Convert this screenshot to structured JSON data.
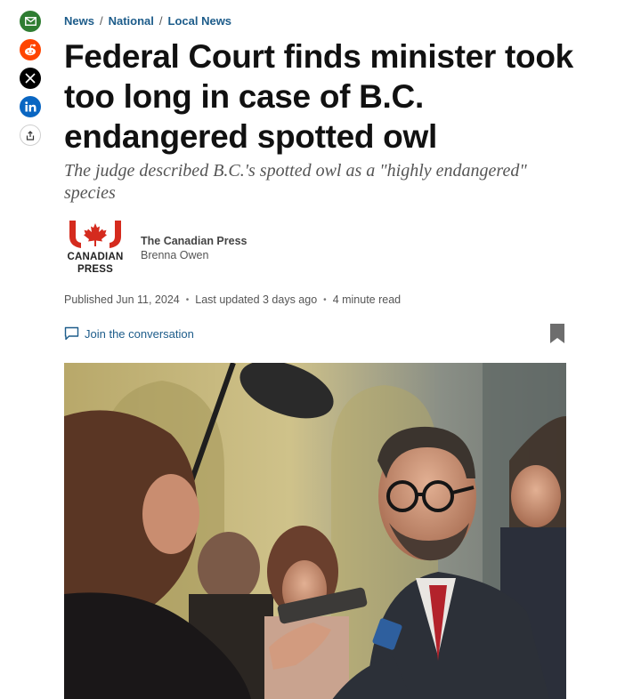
{
  "share": {
    "buttons": [
      {
        "name": "email",
        "icon": "envelope-icon",
        "color": "#2f7d32"
      },
      {
        "name": "reddit",
        "icon": "reddit-icon",
        "color": "#ff4500"
      },
      {
        "name": "x",
        "icon": "x-logo-icon",
        "color": "#000000"
      },
      {
        "name": "linkedin",
        "icon": "linkedin-icon",
        "color": "#0a66c2"
      },
      {
        "name": "more",
        "icon": "share-icon",
        "color": "#ffffff"
      }
    ]
  },
  "breadcrumb": {
    "items": [
      "News",
      "National",
      "Local News"
    ],
    "separator": "/",
    "color": "#1d5c8a"
  },
  "article": {
    "headline": "Federal Court finds minister took too long in case of B.C. endangered spotted owl",
    "dek": "The judge described B.C.'s spotted owl as a \"highly endangered\" species"
  },
  "byline": {
    "logo_line1": "CANADIAN",
    "logo_line2": "PRESS",
    "logo_color": "#d52b1e",
    "source": "The Canadian Press",
    "author": "Brenna Owen"
  },
  "meta": {
    "published": "Published Jun 11, 2024",
    "updated": "Last updated 3 days ago",
    "read_time": "4 minute read",
    "separator": "•"
  },
  "conversation": {
    "label": "Join the conversation",
    "icon": "comment-icon"
  },
  "bookmark": {
    "icon": "bookmark-icon",
    "color": "#6d6d6d"
  },
  "photo": {
    "icon": "news-photo"
  }
}
